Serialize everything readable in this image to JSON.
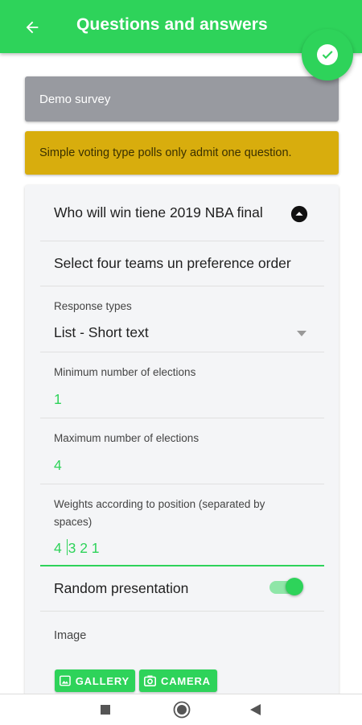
{
  "header": {
    "title": "Questions and answers",
    "back_icon": "arrow-left-icon",
    "confirm_icon": "check-circle-icon"
  },
  "survey": {
    "name": "Demo survey",
    "notice": "Simple voting type polls only admit one question."
  },
  "question": {
    "title": "Who will win tiene 2019 NBA final",
    "collapse_icon": "chevron-up-circle-icon",
    "subtitle": "Select four teams un preference order",
    "response_types_label": "Response types",
    "response_types_value": "List - Short text",
    "min_label": "Minimum number of elections",
    "min_value": "1",
    "max_label": "Maximum number of elections",
    "max_value": "4",
    "weights_label": "Weights according to position (separated by spaces)",
    "weights_before_cursor": "4 ",
    "weights_after_cursor": "3 2 1",
    "random_label": "Random presentation",
    "random_enabled": true,
    "image_label": "Image",
    "gallery_label": "GALLERY",
    "camera_label": "CAMERA"
  },
  "colors": {
    "accent": "#2ed35a",
    "survey_bg": "#989aa0",
    "notice_bg": "#d8ad0d",
    "card_bg": "#f4f5f7"
  },
  "navbar": {
    "icons": [
      "square-icon",
      "circle-home-icon",
      "triangle-back-icon"
    ]
  }
}
